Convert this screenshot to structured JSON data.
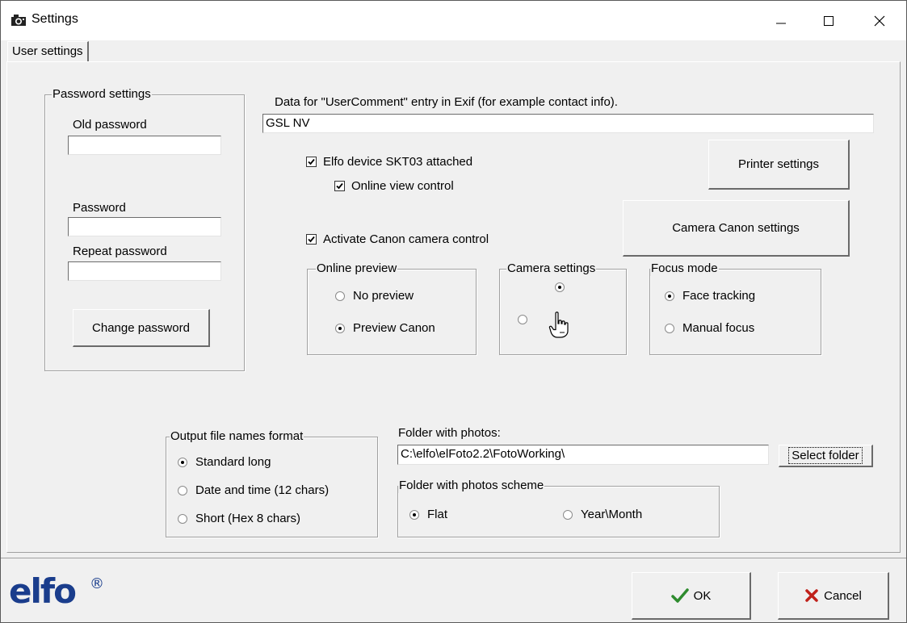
{
  "window": {
    "title": "Settings",
    "icon": "camera-icon"
  },
  "tabs": [
    {
      "label": "User settings",
      "active": true
    }
  ],
  "password_group": {
    "legend": "Password settings",
    "old_password_label": "Old password",
    "old_password_value": "",
    "password_label": "Password",
    "password_value": "",
    "repeat_password_label": "Repeat password",
    "repeat_password_value": "",
    "change_button": "Change password"
  },
  "exif": {
    "label": "Data for \"UserComment\" entry in Exif (for example contact info).",
    "value": "GSL NV"
  },
  "elfo_device": {
    "label": "Elfo device SKT03 attached",
    "checked": true
  },
  "online_view": {
    "label": "Online view control",
    "checked": true
  },
  "canon_control": {
    "label": "Activate Canon camera control",
    "checked": true
  },
  "buttons": {
    "printer_settings": "Printer settings",
    "camera_canon_settings": "Camera Canon settings",
    "select_folder": "Select folder",
    "ok": "OK",
    "cancel": "Cancel"
  },
  "online_preview": {
    "legend": "Online preview",
    "options": [
      {
        "label": "No preview",
        "selected": false
      },
      {
        "label": "Preview Canon",
        "selected": true
      }
    ]
  },
  "camera_settings": {
    "legend": "Camera settings",
    "top_selected": true,
    "left_selected": false,
    "icon": "pointing-hand-icon"
  },
  "focus_mode": {
    "legend": "Focus mode",
    "options": [
      {
        "label": "Face tracking",
        "selected": true
      },
      {
        "label": "Manual focus",
        "selected": false
      }
    ]
  },
  "output_format": {
    "legend": "Output file names format",
    "options": [
      {
        "label": "Standard long",
        "selected": true
      },
      {
        "label": "Date and time (12 chars)",
        "selected": false
      },
      {
        "label": "Short (Hex 8 chars)",
        "selected": false
      }
    ]
  },
  "folder": {
    "label": "Folder with photos:",
    "value": "C:\\elfo\\elFoto2.2\\FotoWorking\\"
  },
  "folder_scheme": {
    "legend": "Folder with photos scheme",
    "options": [
      {
        "label": "Flat",
        "selected": true
      },
      {
        "label": "Year\\Month",
        "selected": false
      }
    ]
  },
  "brand": {
    "logo_text": "elfo",
    "registered": "®"
  },
  "colors": {
    "ok_check": "#2e8b2e",
    "cancel_x": "#c0201a",
    "logo": "#1a3d8c"
  }
}
